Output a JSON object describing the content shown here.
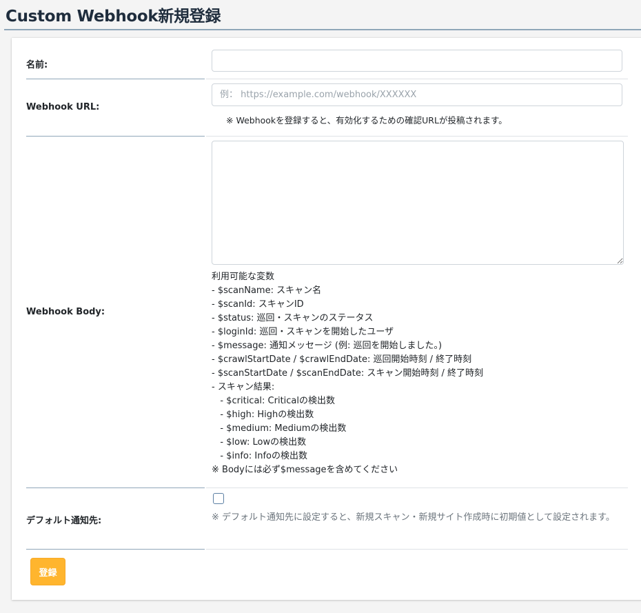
{
  "page": {
    "title": "Custom Webhook新規登録"
  },
  "form": {
    "name_label": "名前:",
    "name_value": "",
    "url_label": "Webhook URL:",
    "url_placeholder": "例： https://example.com/webhook/XXXXXX",
    "url_value": "",
    "url_note": "※ Webhookを登録すると、有効化するための確認URLが投稿されます。",
    "body_label": "Webhook Body:",
    "body_value": "",
    "variables": [
      "利用可能な変数",
      "- $scanName: スキャン名",
      "- $scanId: スキャンID",
      "- $status: 巡回・スキャンのステータス",
      "- $loginId: 巡回・スキャンを開始したユーザ",
      "- $message: 通知メッセージ (例: 巡回を開始しました。)",
      "- $crawlStartDate / $crawlEndDate: 巡回開始時刻 / 終了時刻",
      "- $scanStartDate / $scanEndDate: スキャン開始時刻 / 終了時刻",
      "- スキャン結果:",
      "   - $critical: Criticalの検出数",
      "   - $high: Highの検出数",
      "   - $medium: Mediumの検出数",
      "   - $low: Lowの検出数",
      "   - $info: Infoの検出数",
      "※ Bodyには必ず$messageを含めてください"
    ],
    "default_label": "デフォルト通知先:",
    "default_checked": false,
    "default_note": "※ デフォルト通知先に設定すると、新規スキャン・新規サイト作成時に初期値として設定されます。",
    "submit_label": "登録"
  },
  "colors": {
    "submit_button": "#ffb52e",
    "header_rule": "#8fa6b8"
  }
}
